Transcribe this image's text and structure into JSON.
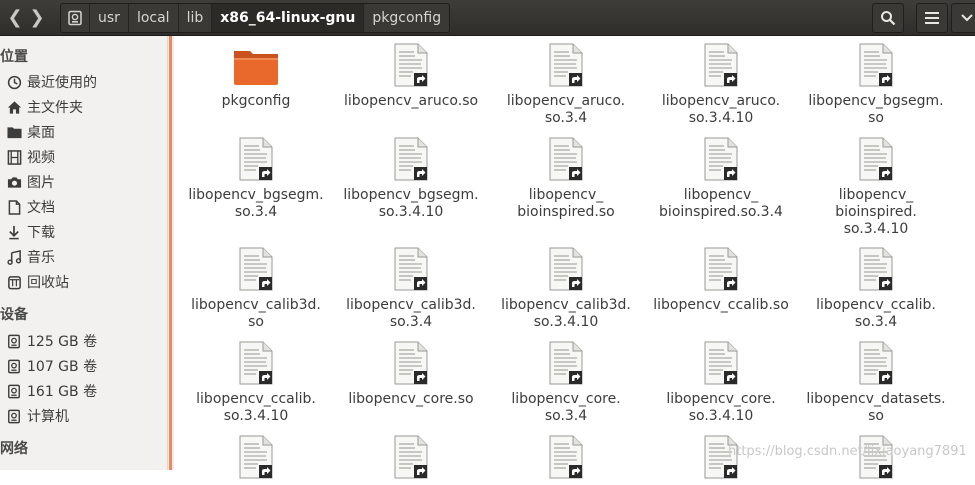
{
  "header": {
    "breadcrumbs": [
      "usr",
      "local",
      "lib",
      "x86_64-linux-gnu",
      "pkgconfig"
    ],
    "active_crumb": "x86_64-linux-gnu"
  },
  "sidebar": {
    "places_heading": "位置",
    "places": [
      {
        "label": "最近使用的",
        "icon": "clock-icon"
      },
      {
        "label": "主文件夹",
        "icon": "home-icon"
      },
      {
        "label": "桌面",
        "icon": "folder-icon"
      },
      {
        "label": "视频",
        "icon": "film-icon"
      },
      {
        "label": "图片",
        "icon": "camera-icon"
      },
      {
        "label": "文档",
        "icon": "document-icon"
      },
      {
        "label": "下载",
        "icon": "download-icon"
      },
      {
        "label": "音乐",
        "icon": "music-icon"
      },
      {
        "label": "回收站",
        "icon": "trash-icon"
      }
    ],
    "devices_heading": "设备",
    "devices": [
      {
        "label": "125 GB 卷",
        "icon": "drive-icon"
      },
      {
        "label": "107 GB 卷",
        "icon": "drive-icon"
      },
      {
        "label": "161 GB 卷",
        "icon": "drive-icon"
      },
      {
        "label": "计算机",
        "icon": "drive-icon"
      }
    ],
    "network_heading": "网络"
  },
  "files": [
    {
      "name": "pkgconfig",
      "type": "folder"
    },
    {
      "name": "libopencv_aruco.so",
      "type": "link"
    },
    {
      "name": "libopencv_aruco.\nso.3.4",
      "type": "link"
    },
    {
      "name": "libopencv_aruco.\nso.3.4.10",
      "type": "link"
    },
    {
      "name": "libopencv_bgsegm.\nso",
      "type": "link"
    },
    {
      "name": "libopencv_bgsegm.\nso.3.4",
      "type": "link"
    },
    {
      "name": "libopencv_bgsegm.\nso.3.4.10",
      "type": "link"
    },
    {
      "name": "libopencv_\nbioinspired.so",
      "type": "link"
    },
    {
      "name": "libopencv_\nbioinspired.so.3.4",
      "type": "link"
    },
    {
      "name": "libopencv_\nbioinspired.\nso.3.4.10",
      "type": "link"
    },
    {
      "name": "libopencv_calib3d.\nso",
      "type": "link"
    },
    {
      "name": "libopencv_calib3d.\nso.3.4",
      "type": "link"
    },
    {
      "name": "libopencv_calib3d.\nso.3.4.10",
      "type": "link"
    },
    {
      "name": "libopencv_ccalib.so",
      "type": "link"
    },
    {
      "name": "libopencv_ccalib.\nso.3.4",
      "type": "link"
    },
    {
      "name": "libopencv_ccalib.\nso.3.4.10",
      "type": "link"
    },
    {
      "name": "libopencv_core.so",
      "type": "link"
    },
    {
      "name": "libopencv_core.\nso.3.4",
      "type": "link"
    },
    {
      "name": "libopencv_core.\nso.3.4.10",
      "type": "link"
    },
    {
      "name": "libopencv_datasets.\nso",
      "type": "link"
    },
    {
      "name": "",
      "type": "link"
    },
    {
      "name": "",
      "type": "link"
    },
    {
      "name": "",
      "type": "link"
    },
    {
      "name": "",
      "type": "link"
    },
    {
      "name": "",
      "type": "link"
    }
  ],
  "watermark": "https://blog.csdn.net/lixiaoyang7891",
  "colors": {
    "accent": "#f07746",
    "folder": "#e9692c"
  }
}
